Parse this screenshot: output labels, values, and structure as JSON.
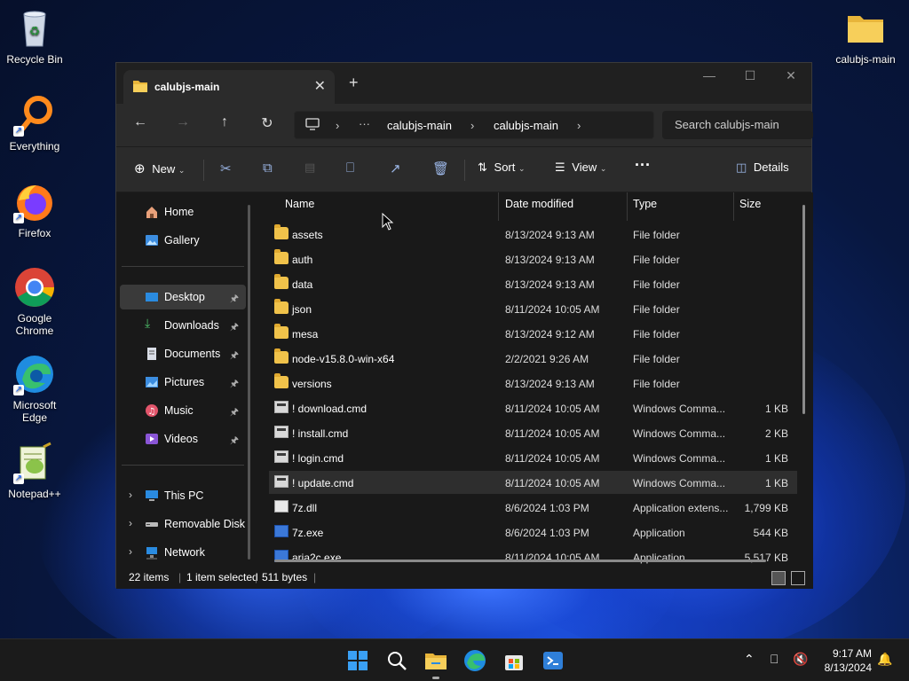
{
  "desktop": {
    "icons": [
      {
        "label": "Recycle Bin"
      },
      {
        "label": "Everything"
      },
      {
        "label": "Firefox"
      },
      {
        "label": "Google Chrome"
      },
      {
        "label": "Microsoft Edge"
      },
      {
        "label": "Notepad++"
      },
      {
        "label": "calubjs-main"
      }
    ]
  },
  "window": {
    "tab_title": "calubjs-main",
    "new_tab": "+",
    "address": {
      "ellipsis": "···",
      "crumbs": [
        "calubjs-main",
        "calubjs-main"
      ]
    },
    "search_placeholder": "Search calubjs-main",
    "toolbar": {
      "new_label": "New",
      "sort_label": "Sort",
      "view_label": "View",
      "more_label": "···",
      "details_label": "Details"
    },
    "nav": {
      "home": "Home",
      "gallery": "Gallery",
      "quick": [
        {
          "label": "Desktop"
        },
        {
          "label": "Downloads"
        },
        {
          "label": "Documents"
        },
        {
          "label": "Pictures"
        },
        {
          "label": "Music"
        },
        {
          "label": "Videos"
        }
      ],
      "this_pc": "This PC",
      "removable": "Removable Disk",
      "network": "Network"
    },
    "columns": {
      "name": "Name",
      "date": "Date modified",
      "type": "Type",
      "size": "Size"
    },
    "files": [
      {
        "name": "assets",
        "date": "8/13/2024 9:13 AM",
        "type": "File folder",
        "size": "",
        "kind": "folder"
      },
      {
        "name": "auth",
        "date": "8/13/2024 9:13 AM",
        "type": "File folder",
        "size": "",
        "kind": "folder"
      },
      {
        "name": "data",
        "date": "8/13/2024 9:13 AM",
        "type": "File folder",
        "size": "",
        "kind": "folder"
      },
      {
        "name": "json",
        "date": "8/11/2024 10:05 AM",
        "type": "File folder",
        "size": "",
        "kind": "folder"
      },
      {
        "name": "mesa",
        "date": "8/13/2024 9:12 AM",
        "type": "File folder",
        "size": "",
        "kind": "folder"
      },
      {
        "name": "node-v15.8.0-win-x64",
        "date": "2/2/2021 9:26 AM",
        "type": "File folder",
        "size": "",
        "kind": "folder"
      },
      {
        "name": "versions",
        "date": "8/13/2024 9:13 AM",
        "type": "File folder",
        "size": "",
        "kind": "folder"
      },
      {
        "name": "! download.cmd",
        "date": "8/11/2024 10:05 AM",
        "type": "Windows Comma...",
        "size": "1 KB",
        "kind": "cmd"
      },
      {
        "name": "! install.cmd",
        "date": "8/11/2024 10:05 AM",
        "type": "Windows Comma...",
        "size": "2 KB",
        "kind": "cmd"
      },
      {
        "name": "! login.cmd",
        "date": "8/11/2024 10:05 AM",
        "type": "Windows Comma...",
        "size": "1 KB",
        "kind": "cmd"
      },
      {
        "name": "! update.cmd",
        "date": "8/11/2024 10:05 AM",
        "type": "Windows Comma...",
        "size": "1 KB",
        "kind": "cmd",
        "selected": true
      },
      {
        "name": "7z.dll",
        "date": "8/6/2024 1:03 PM",
        "type": "Application extens...",
        "size": "1,799 KB",
        "kind": "dll"
      },
      {
        "name": "7z.exe",
        "date": "8/6/2024 1:03 PM",
        "type": "Application",
        "size": "544 KB",
        "kind": "exe"
      },
      {
        "name": "aria2c.exe",
        "date": "8/11/2024 10:05 AM",
        "type": "Application",
        "size": "5,517 KB",
        "kind": "exe"
      }
    ],
    "status": {
      "count": "22 items",
      "selected": "1 item selected",
      "bytes": "511 bytes"
    }
  },
  "taskbar": {
    "time": "9:17 AM",
    "date": "8/13/2024"
  }
}
